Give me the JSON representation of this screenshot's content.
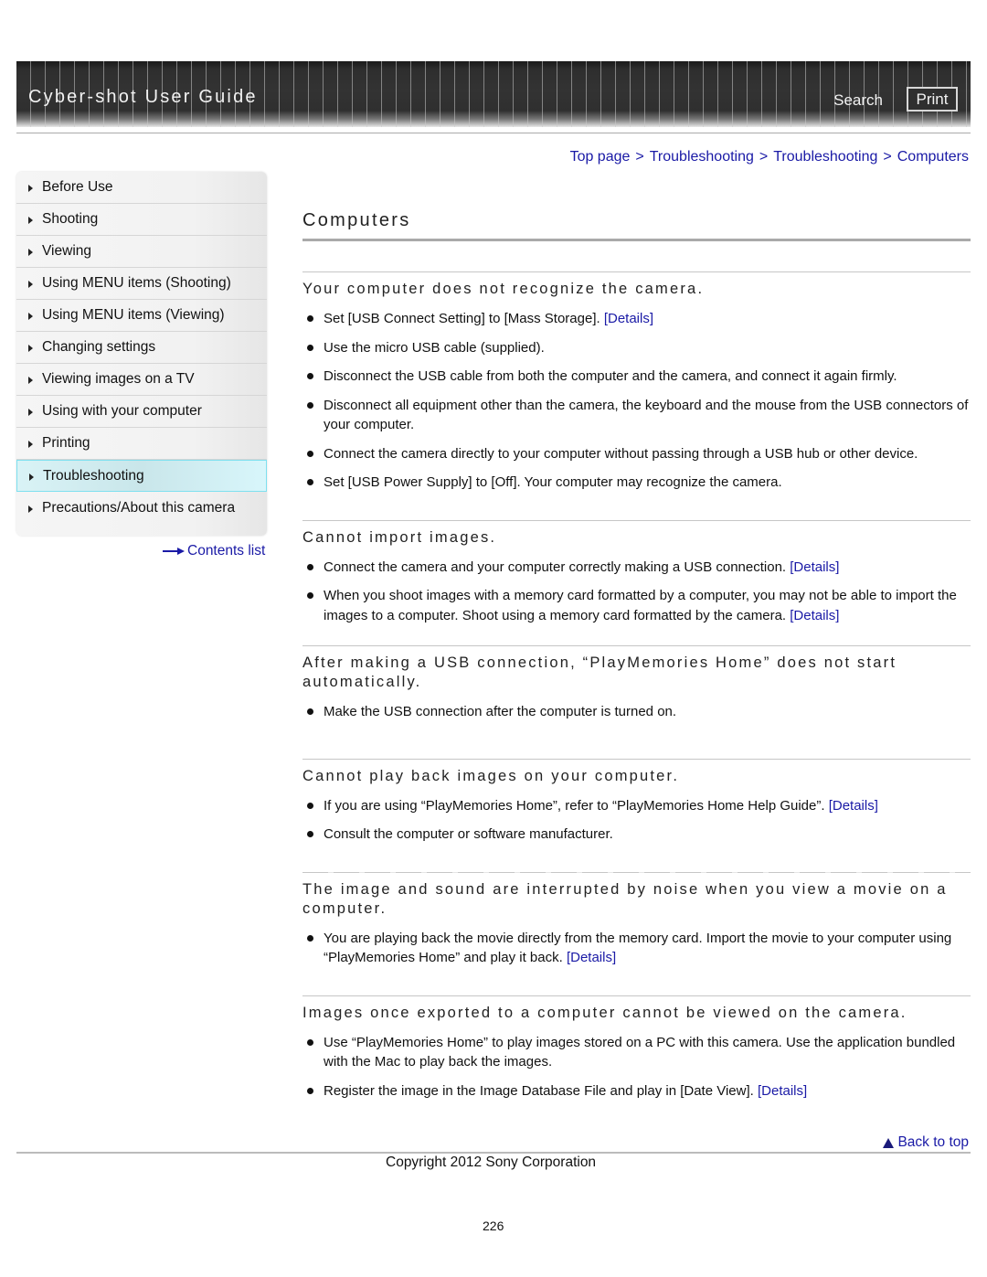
{
  "header": {
    "title": "Cyber-shot User Guide",
    "search_label": "Search",
    "print_label": "Print"
  },
  "breadcrumb": [
    {
      "label": "Top page"
    },
    {
      "label": "Troubleshooting"
    },
    {
      "label": "Troubleshooting"
    },
    {
      "label": "Computers"
    }
  ],
  "breadcrumb_separator": ">",
  "sidebar": {
    "items": [
      {
        "label": "Before Use",
        "active": false
      },
      {
        "label": "Shooting",
        "active": false
      },
      {
        "label": "Viewing",
        "active": false
      },
      {
        "label": "Using MENU items (Shooting)",
        "active": false
      },
      {
        "label": "Using MENU items (Viewing)",
        "active": false
      },
      {
        "label": "Changing settings",
        "active": false
      },
      {
        "label": "Viewing images on a TV",
        "active": false
      },
      {
        "label": "Using with your computer",
        "active": false
      },
      {
        "label": "Printing",
        "active": false
      },
      {
        "label": "Troubleshooting",
        "active": true
      },
      {
        "label": "Precautions/About this camera",
        "active": false
      }
    ],
    "contents_link": "Contents list",
    "active_bg": "#d2eef2",
    "active_border": "#7fe0ef"
  },
  "main": {
    "title": "Computers",
    "sections": [
      {
        "title": "Your computer does not recognize the camera.",
        "items": [
          {
            "text": "Set [USB Connect Setting] to [Mass Storage]. ",
            "link": "[Details]"
          },
          {
            "text": "Use the micro USB cable (supplied).",
            "link": null
          },
          {
            "text": "Disconnect the USB cable from both the computer and the camera, and connect it again firmly.",
            "link": null
          },
          {
            "text": "Disconnect all equipment other than the camera, the keyboard and the mouse from the USB connectors of your computer.",
            "link": null
          },
          {
            "text": "Connect the camera directly to your computer without passing through a USB hub or other device.",
            "link": null
          },
          {
            "text": "Set [USB Power Supply] to [Off]. Your computer may recognize the camera.",
            "link": null
          }
        ]
      },
      {
        "title": "Cannot import images.",
        "items": [
          {
            "text": "Connect the camera and your computer correctly making a USB connection. ",
            "link": "[Details]"
          },
          {
            "text": "When you shoot images with a memory card formatted by a computer, you may not be able to import the images to a computer. Shoot using a memory card formatted by the camera. ",
            "link": "[Details]"
          }
        ]
      },
      {
        "title": "After making a USB connection, “PlayMemories Home” does not start automatically.",
        "items": [
          {
            "text": "Make the USB connection after the computer is turned on.",
            "link": null
          }
        ]
      },
      {
        "title": "Cannot play back images on your computer.",
        "items": [
          {
            "text": "If you are using “PlayMemories Home”, refer to “PlayMemories Home Help Guide”. ",
            "link": "[Details]"
          },
          {
            "text": "Consult the computer or software manufacturer.",
            "link": null
          }
        ]
      },
      {
        "title": "The image and sound are interrupted by noise when you view a movie on a computer.",
        "items": [
          {
            "text": "You are playing back the movie directly from the memory card. Import the movie to your computer using “PlayMemories Home” and play it back. ",
            "link": "[Details]"
          }
        ]
      },
      {
        "title": "Images once exported to a computer cannot be viewed on the camera.",
        "items": [
          {
            "text": "Use “PlayMemories Home” to play images stored on a PC with this camera. Use the application bundled with the Mac to play back the images.",
            "link": null
          },
          {
            "text": "Register the image in the Image Database File and play in [Date View]. ",
            "link": "[Details]"
          }
        ]
      }
    ]
  },
  "footer": {
    "back_to_top": "Back to top",
    "copyright": "Copyright 2012 Sony Corporation",
    "page_number": "226"
  },
  "colors": {
    "link": "#1a1aa6",
    "header_bg": "#333333"
  }
}
